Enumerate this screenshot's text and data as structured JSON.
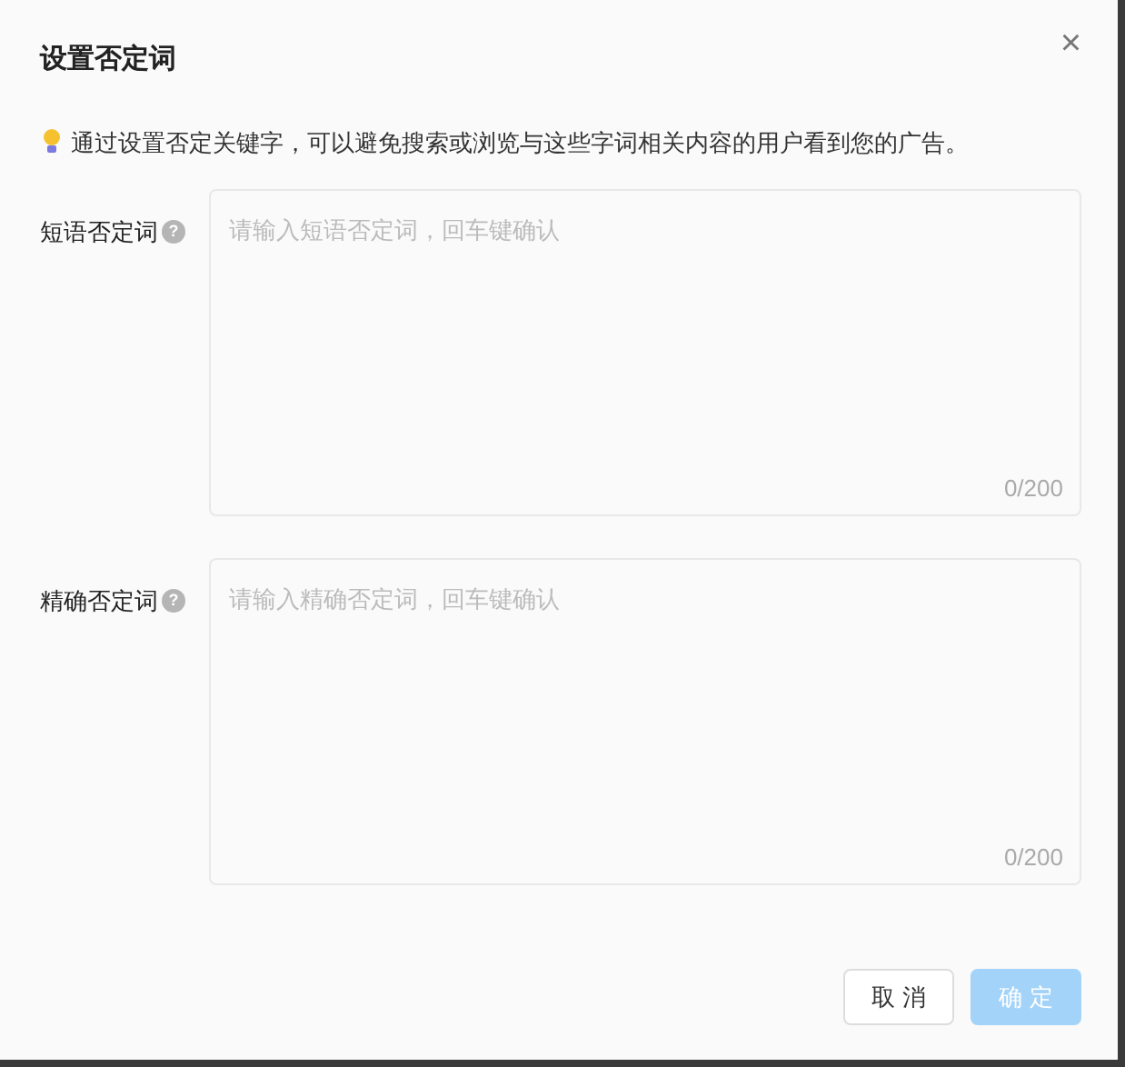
{
  "dialog": {
    "title": "设置否定词",
    "close": "×",
    "tip": "通过设置否定关键字，可以避免搜索或浏览与这些字词相关内容的用户看到您的广告。"
  },
  "fields": [
    {
      "label": "短语否定词",
      "help": "?",
      "placeholder": "请输入短语否定词，回车键确认",
      "count": "0/200"
    },
    {
      "label": "精确否定词",
      "help": "?",
      "placeholder": "请输入精确否定词，回车键确认",
      "count": "0/200"
    }
  ],
  "buttons": [
    {
      "label": "取 消",
      "kind": "secondary",
      "disabled": false
    },
    {
      "label": "确 定",
      "kind": "primary",
      "disabled": true
    }
  ]
}
